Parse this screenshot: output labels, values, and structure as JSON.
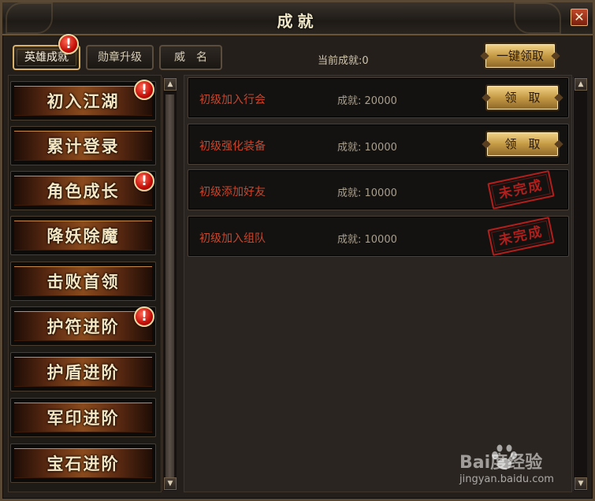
{
  "window": {
    "title": "成就",
    "close_glyph": "✕"
  },
  "tabs": [
    {
      "label": "英雄成就",
      "active": true,
      "has_alert": true
    },
    {
      "label": "勋章升级",
      "active": false,
      "has_alert": false
    },
    {
      "label": "威　名",
      "active": false,
      "has_alert": false
    }
  ],
  "header": {
    "status_text": "当前成就:0",
    "claim_all_label": "一键领取"
  },
  "alert_badge_glyph": "!",
  "categories": [
    {
      "label": "初入江湖",
      "has_alert": true
    },
    {
      "label": "累计登录",
      "has_alert": false
    },
    {
      "label": "角色成长",
      "has_alert": true
    },
    {
      "label": "降妖除魔",
      "has_alert": false
    },
    {
      "label": "击败首领",
      "has_alert": false
    },
    {
      "label": "护符进阶",
      "has_alert": true
    },
    {
      "label": "护盾进阶",
      "has_alert": false
    },
    {
      "label": "军印进阶",
      "has_alert": false
    },
    {
      "label": "宝石进阶",
      "has_alert": false
    }
  ],
  "achievements": [
    {
      "name": "初级加入行会",
      "points": "成就: 20000",
      "status": "claim",
      "claim_label": "领　取"
    },
    {
      "name": "初级强化装备",
      "points": "成就: 10000",
      "status": "claim",
      "claim_label": "领　取"
    },
    {
      "name": "初级添加好友",
      "points": "成就: 10000",
      "status": "incomplete",
      "stamp_label": "未完成"
    },
    {
      "name": "初级加入组队",
      "points": "成就: 10000",
      "status": "incomplete",
      "stamp_label": "未完成"
    }
  ],
  "scroll_glyphs": {
    "up": "▲",
    "down": "▼"
  },
  "watermark": {
    "brand": "Bai度经验",
    "url": "jingyan.baidu.com",
    "icon": "paw-icon"
  },
  "colors": {
    "achievement_name": "#c9452a",
    "stamp_red": "#c0201c",
    "gold_button": "#c59a45",
    "alert_red": "#c40e08"
  }
}
